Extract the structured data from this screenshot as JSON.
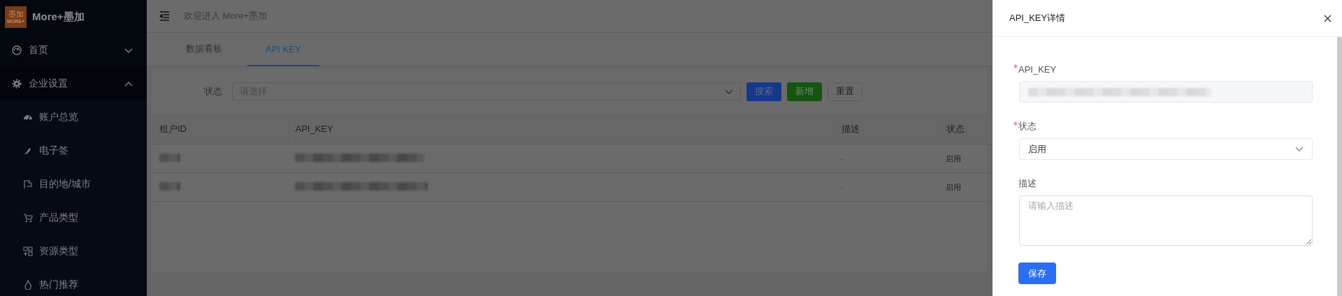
{
  "sidebar": {
    "logo_text": "墨加",
    "logo_subtext": "MORE+",
    "brand": "More+墨加",
    "items": [
      {
        "label": "首页",
        "expanded": false
      },
      {
        "label": "企业设置",
        "expanded": true,
        "children": [
          {
            "label": "账户总览"
          },
          {
            "label": "电子签"
          },
          {
            "label": "目的地/城市"
          },
          {
            "label": "产品类型"
          },
          {
            "label": "资源类型"
          },
          {
            "label": "热门推荐"
          }
        ]
      }
    ]
  },
  "header": {
    "welcome": "欢迎进入 More+墨加"
  },
  "tabs": [
    {
      "label": "数据看板",
      "selected": false
    },
    {
      "label": "API KEY",
      "selected": true
    }
  ],
  "filter": {
    "label": "状态",
    "placeholder": "请选择",
    "buttons": [
      {
        "label": "搜索",
        "kind": "primary"
      },
      {
        "label": "新增",
        "kind": "success"
      },
      {
        "label": "重置",
        "kind": "default"
      }
    ]
  },
  "table": {
    "columns": [
      "租户ID",
      "API_KEY",
      "描述",
      "状态"
    ],
    "rows": [
      {
        "description": "-",
        "status": "启用"
      },
      {
        "description": "-",
        "status": "启用"
      }
    ]
  },
  "drawer": {
    "title": "API_KEY详情",
    "fields": [
      {
        "label": "API_KEY",
        "required": true,
        "kind": "redacted"
      },
      {
        "label": "状态",
        "required": true,
        "kind": "select",
        "value": "启用"
      },
      {
        "label": "描述",
        "required": false,
        "kind": "textarea",
        "placeholder": "请输入描述"
      }
    ],
    "save_button": "保存"
  }
}
